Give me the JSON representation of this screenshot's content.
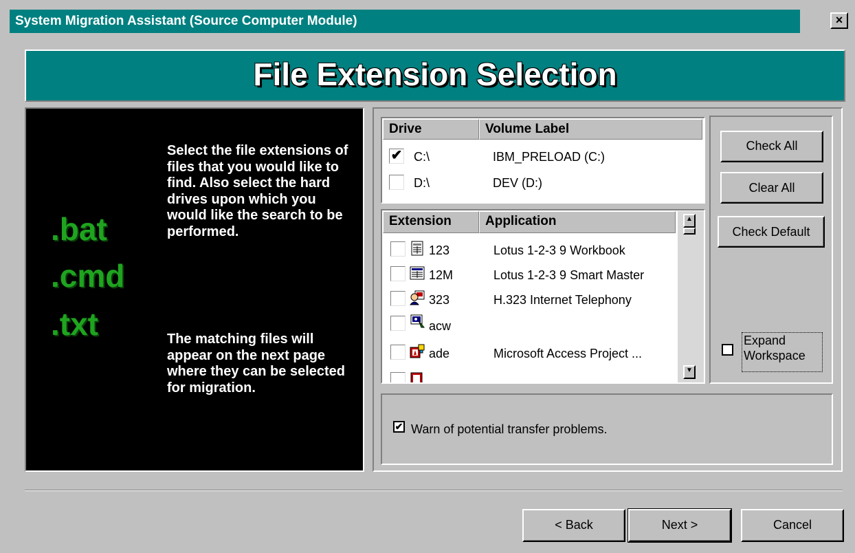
{
  "window": {
    "title": "System Migration Assistant (Source Computer Module)",
    "close_label": "×"
  },
  "banner": {
    "title": "File Extension Selection"
  },
  "info": {
    "extensions": [
      ".bat",
      ".cmd",
      ".txt"
    ],
    "paragraph1": "Select the file extensions of files that you would like to find.  Also select the hard drives upon which you would like the search to be performed.",
    "paragraph2": "The matching files will appear on the next page where they can be selected for migration."
  },
  "drives": {
    "headers": [
      "Drive",
      "Volume Label"
    ],
    "rows": [
      {
        "drive": "C:\\",
        "label": "IBM_PRELOAD (C:)",
        "checked": true,
        "mark": "✔"
      },
      {
        "drive": "D:\\",
        "label": "DEV (D:)",
        "checked": false,
        "mark": ""
      }
    ]
  },
  "extensions": {
    "headers": [
      "Extension",
      "Application"
    ],
    "rows": [
      {
        "ext": "123",
        "app": "Lotus 1-2-3 9 Workbook",
        "icon": "lotus-workbook-icon"
      },
      {
        "ext": "12M",
        "app": "Lotus 1-2-3 9 Smart Master",
        "icon": "lotus-smartmaster-icon"
      },
      {
        "ext": "323",
        "app": "H.323 Internet Telephony",
        "icon": "telephony-icon"
      },
      {
        "ext": "acw",
        "app": "",
        "icon": "accessibility-wizard-icon"
      },
      {
        "ext": "ade",
        "app": "Microsoft Access Project ...",
        "icon": "access-project-icon"
      }
    ]
  },
  "side_buttons": {
    "check_all": "Check All",
    "clear_all": "Clear All",
    "check_default": "Check Default"
  },
  "expand": {
    "line1": "Expand",
    "line2": "Workspace",
    "checked": false
  },
  "warn": {
    "label": "Warn of potential transfer problems.",
    "checked": true,
    "mark": "✔"
  },
  "nav": {
    "back": "< Back",
    "next": "Next >",
    "cancel": "Cancel"
  },
  "colors": {
    "title_bar": "#008080",
    "banner": "#008080",
    "extension_text": "#1fa41f",
    "panel_bg": "#000000",
    "window_bg": "#c0c0c0"
  }
}
